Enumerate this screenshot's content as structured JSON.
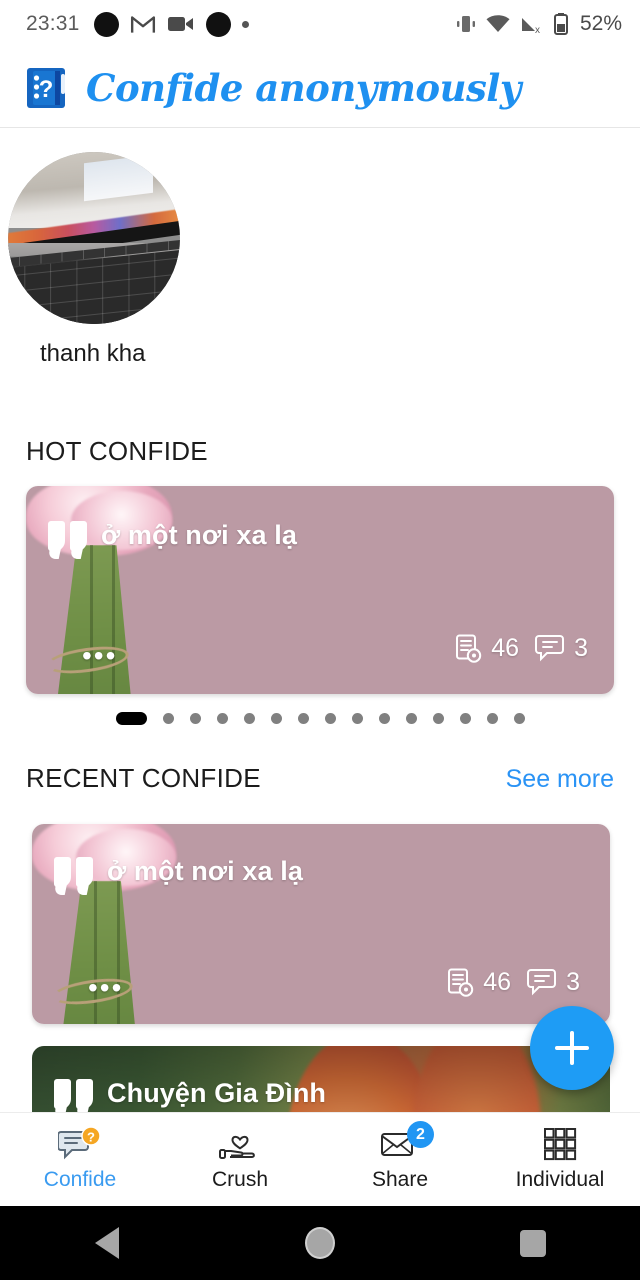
{
  "status_bar": {
    "time": "23:31",
    "battery_percent": "52%",
    "left_icons": [
      "circle-icon",
      "gmail-icon",
      "video-camera-icon",
      "circle-icon",
      "small-dot-icon"
    ],
    "right_icons": [
      "vibrate-icon",
      "wifi-icon",
      "cellular-off-icon",
      "battery-icon"
    ]
  },
  "header": {
    "title": "Confide anonymously",
    "logo": "question-notebook-icon",
    "brand_color": "#1e90f0"
  },
  "profile": {
    "name": "thanh kha",
    "avatar": "macbook-keyboard-photo"
  },
  "sections": {
    "hot": {
      "title": "HOT CONFIDE"
    },
    "recent": {
      "title": "RECENT CONFIDE",
      "see_more": "See more",
      "see_more_color": "#2a93f5"
    }
  },
  "hot_card": {
    "title": "ở một nơi xa lạ",
    "views": "46",
    "comments": "3",
    "ellipsis": "•••",
    "background": "pink-flowers",
    "bg_color": "#bb9aa4"
  },
  "pager": {
    "total": 15,
    "active_index": 0
  },
  "recent_cards": [
    {
      "title": "ở một nơi xa lạ",
      "views": "46",
      "comments": "3",
      "ellipsis": "•••",
      "background": "pink-flowers",
      "bg_color": "#bb9aa4"
    },
    {
      "title": "Chuyện Gia Đình",
      "background": "orange-tulips"
    }
  ],
  "fab": {
    "label": "+",
    "name": "create-confide-button",
    "color": "#1e9cf5"
  },
  "bottom_nav": {
    "active": "Confide",
    "items": [
      {
        "label": "Confide",
        "icon": "chat-question-icon",
        "badge": ""
      },
      {
        "label": "Crush",
        "icon": "hand-heart-icon",
        "badge": ""
      },
      {
        "label": "Share",
        "icon": "envelope-icon",
        "badge": "2"
      },
      {
        "label": "Individual",
        "icon": "grid-icon",
        "badge": ""
      }
    ]
  },
  "android_nav": {
    "back": "back-triangle-icon",
    "home": "home-circle-icon",
    "recents": "recents-square-icon"
  }
}
